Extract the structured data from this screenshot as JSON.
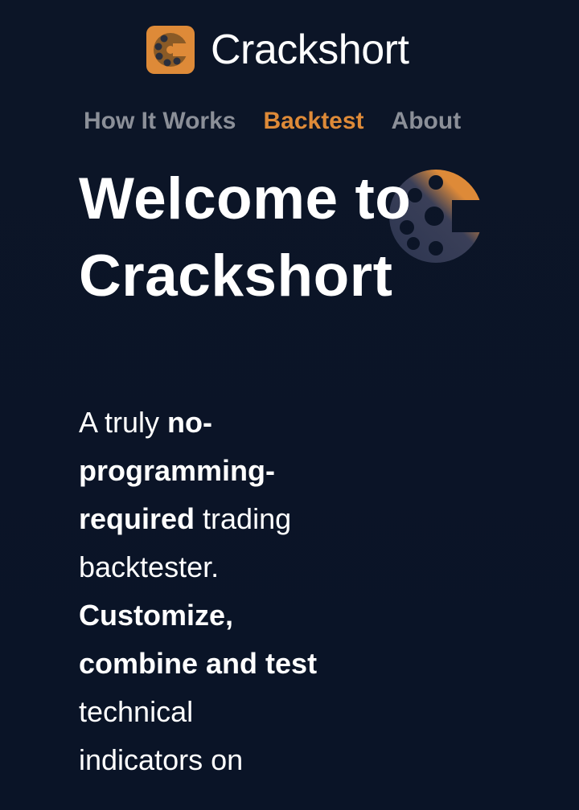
{
  "brand": {
    "name": "Crackshort",
    "icon": "crackshort-logo-icon"
  },
  "nav": {
    "items": [
      {
        "label": "How It Works",
        "active": false
      },
      {
        "label": "Backtest",
        "active": true
      },
      {
        "label": "About",
        "active": false
      }
    ]
  },
  "hero": {
    "title": "Welcome to Crackshort",
    "logo": "crackshort-chamber-icon",
    "copy": {
      "intro": "A truly ",
      "bold1": "no-programming-required",
      "mid": " trading backtester. ",
      "bold2": "Customize, combine and test",
      "tail": " technical indicators on"
    }
  },
  "colors": {
    "background": "#0b1426",
    "accent": "#de8a38",
    "nav_inactive": "#8b8f98",
    "text": "#ffffff",
    "logo_dark": "#2c3550"
  }
}
